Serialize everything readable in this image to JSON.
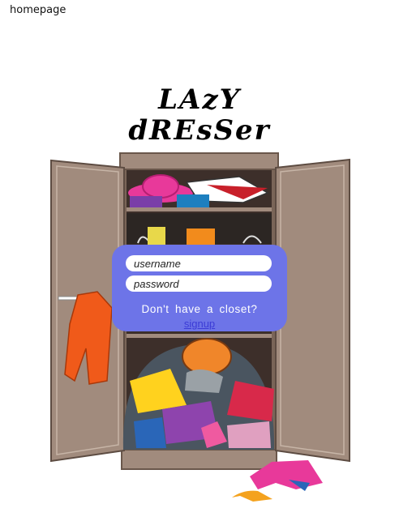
{
  "page": {
    "label": "homepage"
  },
  "logo": {
    "line1": "LAzY",
    "line2": "dREsSer"
  },
  "login": {
    "username_placeholder": "username",
    "password_placeholder": "password",
    "prompt": "Don't have a closet?",
    "signup_link": "signup"
  },
  "colors": {
    "panel": "#6d74e8",
    "wardrobe": "#a18b7d",
    "link": "#3b3bd6"
  },
  "illustration": {
    "name": "messy-wardrobe-icon"
  }
}
